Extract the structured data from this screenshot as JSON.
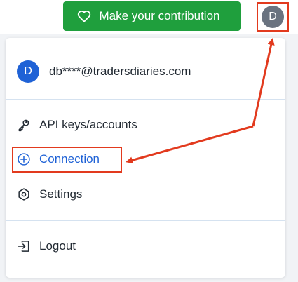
{
  "header": {
    "contribute_label": "Make your contribution",
    "avatar_initial": "D"
  },
  "menu": {
    "avatar_initial": "D",
    "email": "db****@tradersdiaries.com",
    "items": [
      {
        "label": "API keys/accounts",
        "icon": "key-icon"
      },
      {
        "label": "Connection",
        "icon": "plus-circle-icon",
        "highlighted": true
      },
      {
        "label": "Settings",
        "icon": "gear-icon"
      },
      {
        "label": "Logout",
        "icon": "logout-icon"
      }
    ]
  },
  "colors": {
    "contribute_green": "#1f9f3d",
    "accent_blue": "#1f62d6",
    "annotation_red": "#e23a1e",
    "avatar_gray": "#6a7380"
  }
}
